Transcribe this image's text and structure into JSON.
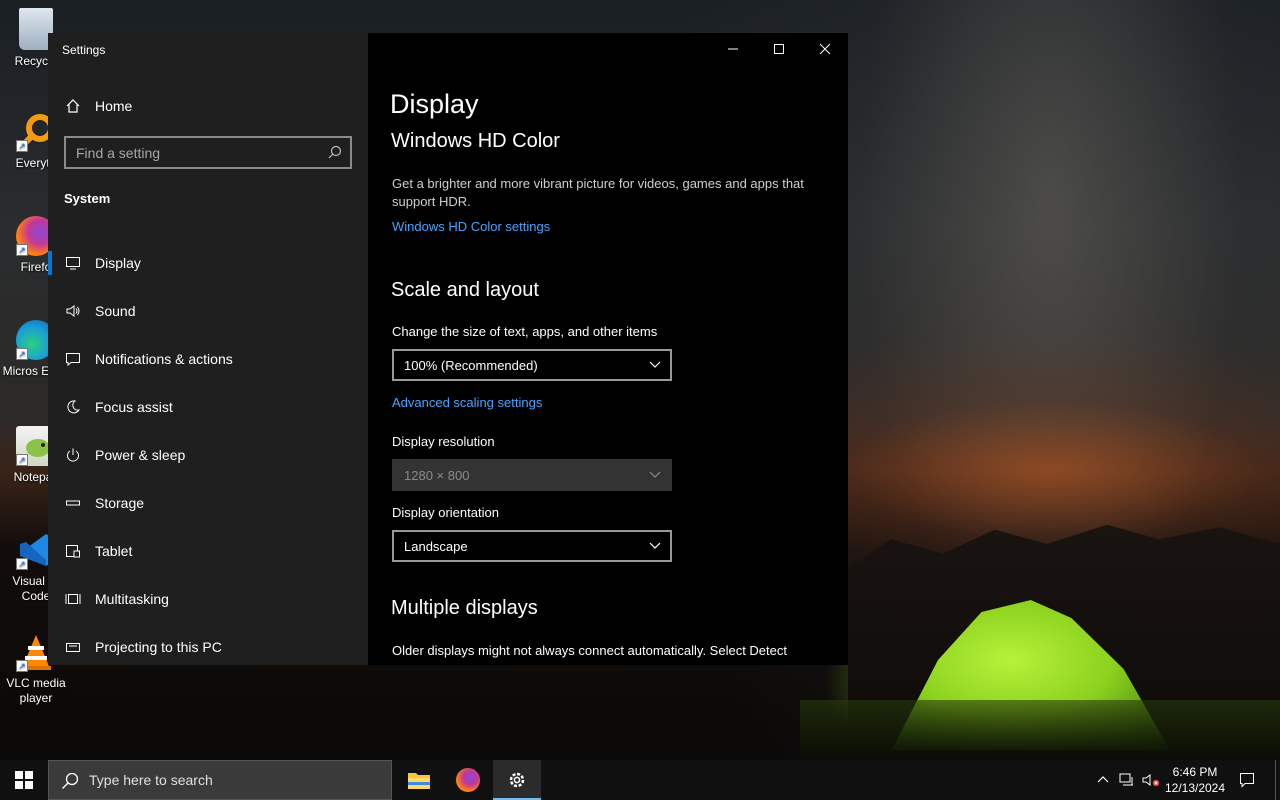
{
  "desktop": {
    "icons": [
      {
        "label": "Recycle",
        "icon": "recycle-bin-icon"
      },
      {
        "label": "Everyth",
        "icon": "everything-search-icon"
      },
      {
        "label": "Firefo",
        "icon": "firefox-icon"
      },
      {
        "label": "Micros Edge",
        "icon": "edge-icon"
      },
      {
        "label": "Notepac",
        "icon": "notepad-plus-plus-icon"
      },
      {
        "label": "Visual St Code",
        "icon": "vscode-icon"
      },
      {
        "label": "VLC media player",
        "icon": "vlc-icon"
      }
    ]
  },
  "window": {
    "app_title": "Settings",
    "controls": [
      "minimize",
      "maximize",
      "close"
    ]
  },
  "sidebar": {
    "home_label": "Home",
    "search_placeholder": "Find a setting",
    "section": "System",
    "items": [
      {
        "label": "Display",
        "icon": "monitor-icon",
        "active": true
      },
      {
        "label": "Sound",
        "icon": "speaker-icon"
      },
      {
        "label": "Notifications & actions",
        "icon": "notification-icon"
      },
      {
        "label": "Focus assist",
        "icon": "moon-icon"
      },
      {
        "label": "Power & sleep",
        "icon": "power-icon"
      },
      {
        "label": "Storage",
        "icon": "storage-icon"
      },
      {
        "label": "Tablet",
        "icon": "tablet-icon"
      },
      {
        "label": "Multitasking",
        "icon": "multitasking-icon"
      },
      {
        "label": "Projecting to this PC",
        "icon": "projecting-icon"
      }
    ]
  },
  "content": {
    "title": "Display",
    "hd_color": {
      "heading": "Windows HD Color",
      "description": "Get a brighter and more vibrant picture for videos, games and apps that support HDR.",
      "link": "Windows HD Color settings"
    },
    "scale_layout": {
      "heading": "Scale and layout",
      "scale_label": "Change the size of text, apps, and other items",
      "scale_value": "100% (Recommended)",
      "advanced_link": "Advanced scaling settings",
      "resolution_label": "Display resolution",
      "resolution_value": "1280 × 800",
      "orientation_label": "Display orientation",
      "orientation_value": "Landscape"
    },
    "multiple_displays": {
      "heading": "Multiple displays",
      "description": "Older displays might not always connect automatically. Select Detect"
    }
  },
  "taskbar": {
    "search_placeholder": "Type here to search",
    "apps": [
      "file-explorer-icon",
      "firefox-icon",
      "settings-gear-icon"
    ],
    "clock_time": "6:46 PM",
    "clock_date": "12/13/2024"
  },
  "colors": {
    "accent": "#0078d7",
    "link": "#4aa3ff",
    "sidebar_bg": "#1f1f1f",
    "content_bg": "#000000"
  }
}
